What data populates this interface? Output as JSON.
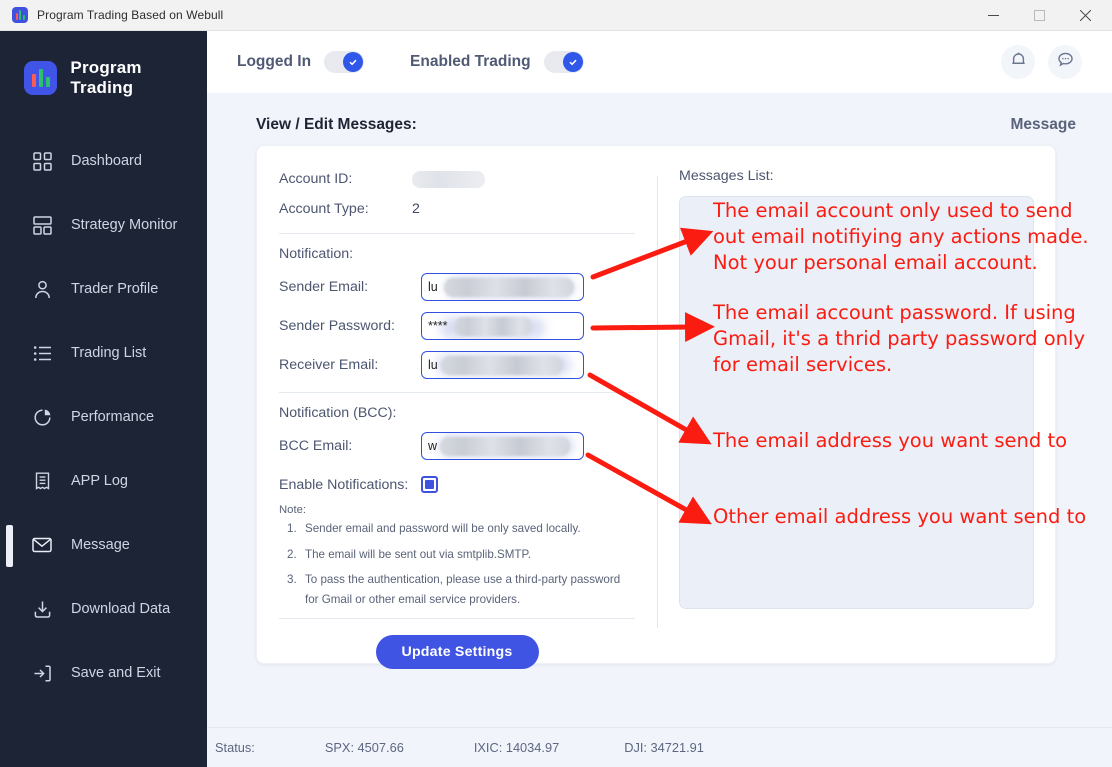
{
  "window": {
    "title": "Program Trading Based on Webull",
    "controls": {
      "minimize": "minimize-icon",
      "maximize": "maximize-icon",
      "close": "close-icon"
    }
  },
  "sidebar": {
    "brand": "Program Trading",
    "items": [
      {
        "label": "Dashboard",
        "icon": "grid-icon",
        "active": false
      },
      {
        "label": "Strategy Monitor",
        "icon": "layout-icon",
        "active": false
      },
      {
        "label": "Trader Profile",
        "icon": "user-icon",
        "active": false
      },
      {
        "label": "Trading List",
        "icon": "list-icon",
        "active": false
      },
      {
        "label": "Performance",
        "icon": "pie-chart-icon",
        "active": false
      },
      {
        "label": "APP Log",
        "icon": "receipt-icon",
        "active": false
      },
      {
        "label": "Message",
        "icon": "envelope-icon",
        "active": true
      },
      {
        "label": "Download Data",
        "icon": "download-icon",
        "active": false
      },
      {
        "label": "Save and Exit",
        "icon": "exit-icon",
        "active": false
      }
    ]
  },
  "header": {
    "toggles": [
      {
        "label": "Logged In",
        "state": "on"
      },
      {
        "label": "Enabled Trading",
        "state": "on"
      }
    ],
    "icons": [
      {
        "name": "bell-icon"
      },
      {
        "name": "chat-icon"
      }
    ]
  },
  "main": {
    "page_title": "View / Edit Messages:",
    "page_kicker": "Message",
    "account": {
      "id_label": "Account ID:",
      "id_value": "",
      "type_label": "Account Type:",
      "type_value": "2"
    },
    "notification": {
      "section_label": "Notification:",
      "fields": [
        {
          "label": "Sender Email:",
          "value": "lu",
          "redacted": true
        },
        {
          "label": "Sender Password:",
          "value": "****",
          "redacted": true
        },
        {
          "label": "Receiver Email:",
          "value": "lu",
          "redacted": true
        }
      ]
    },
    "notification_bcc": {
      "section_label": "Notification (BCC):",
      "fields": [
        {
          "label": "BCC Email:",
          "value": "w",
          "redacted": true
        }
      ]
    },
    "enable_notifications": {
      "label": "Enable Notifications:",
      "checked": true
    },
    "note": {
      "label": "Note:",
      "items": [
        {
          "num": "1.",
          "text": "Sender email and password will be only saved locally."
        },
        {
          "num": "2.",
          "text": "The email will be sent out via smtplib.SMTP."
        },
        {
          "num": "3.",
          "text": "To pass the authentication, please use a third-party password"
        }
      ],
      "continuation": "for Gmail or other email service providers."
    },
    "update_button": "Update Settings",
    "messages_list_label": "Messages List:"
  },
  "annotations": [
    {
      "text": "The email account only used to send\nout email notifiying any actions made.\nNot your personal email account."
    },
    {
      "text": "The email account password. If using\nGmail, it's a thrid party password only\nfor email services."
    },
    {
      "text": "The email address you want send to"
    },
    {
      "text": "Other email address you want send to"
    }
  ],
  "statusbar": {
    "status_label": "Status:",
    "tickers": [
      {
        "text": "SPX: 4507.66"
      },
      {
        "text": "IXIC: 14034.97"
      },
      {
        "text": "DJI: 34721.91"
      }
    ]
  },
  "colors": {
    "accent": "#4054e4",
    "sidebar_bg": "#1d2436",
    "annotation_red": "#fb1c11",
    "content_bg": "#f1f4fa"
  }
}
